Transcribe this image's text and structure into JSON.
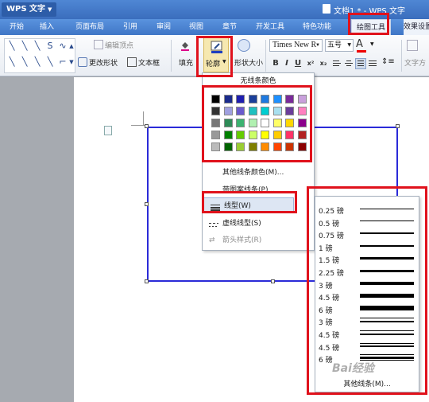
{
  "app": {
    "name": "WPS 文字",
    "doc_title": "文档1 * - WPS 文字"
  },
  "menu": [
    "开始",
    "插入",
    "页面布局",
    "引用",
    "审阅",
    "视图",
    "章节",
    "开发工具",
    "特色功能",
    "绘图工具",
    "效果设置"
  ],
  "ribbon": {
    "edit_vertex": "编辑顶点",
    "change_shape": "更改形状",
    "text_box": "文本框",
    "fill": "填充",
    "outline": "轮廓",
    "shape_size": "形状大小",
    "font": "Times New R",
    "size": "五号",
    "text_direction": "文字方",
    "bold": "B",
    "italic": "I",
    "underline": "U",
    "superscript": "x²",
    "subscript": "x₂",
    "font_color": "A"
  },
  "outline_menu": {
    "no_line": "无线条颜色",
    "more_colors": "其他线条颜色(M)...",
    "pattern": "带图案线条(P)...",
    "line_style": "线型(W)",
    "dash_style": "虚线线型(S)",
    "arrow_style": "箭头样式(R)"
  },
  "palette": [
    [
      "#000000",
      "#1a2b8c",
      "#1f1fb0",
      "#1b3f9a",
      "#1f7ae0",
      "#1e90ff",
      "#7a2a9a",
      "#c9a0dc"
    ],
    [
      "#333333",
      "#a0a0e0",
      "#6a5acd",
      "#20c0c0",
      "#00ced1",
      "#a8e0f0",
      "#6a3d9a",
      "#ff80c0"
    ],
    [
      "#777777",
      "#2e8b57",
      "#3cb371",
      "#b0f0b0",
      "#ffffff",
      "#ffff66",
      "#ffd700",
      "#8b008b"
    ],
    [
      "#999999",
      "#008000",
      "#66cc00",
      "#ccff66",
      "#ffff00",
      "#ffcc00",
      "#ff3366",
      "#b22222"
    ],
    [
      "#bbbbbb",
      "#006400",
      "#9acd32",
      "#808000",
      "#ff8c00",
      "#ff4500",
      "#cc3300",
      "#8b0000"
    ]
  ],
  "line_types": [
    {
      "label": "0.25 磅",
      "w": 1,
      "style": "single"
    },
    {
      "label": "0.5 磅",
      "w": 1,
      "style": "single"
    },
    {
      "label": "0.75 磅",
      "w": 1.5,
      "style": "single"
    },
    {
      "label": "1 磅",
      "w": 2,
      "style": "single"
    },
    {
      "label": "1.5 磅",
      "w": 2.5,
      "style": "single"
    },
    {
      "label": "2.25 磅",
      "w": 3,
      "style": "single"
    },
    {
      "label": "3 磅",
      "w": 4,
      "style": "single"
    },
    {
      "label": "4.5 磅",
      "w": 5,
      "style": "single"
    },
    {
      "label": "6 磅",
      "w": 6,
      "style": "single"
    },
    {
      "label": "3 磅",
      "w": 3,
      "style": "double"
    },
    {
      "label": "4.5 磅",
      "w": 4,
      "style": "double"
    },
    {
      "label": "4.5 磅",
      "w": 4,
      "style": "double-thick"
    },
    {
      "label": "6 磅",
      "w": 5,
      "style": "triple"
    }
  ],
  "more_lines": "其他线条(M)..."
}
